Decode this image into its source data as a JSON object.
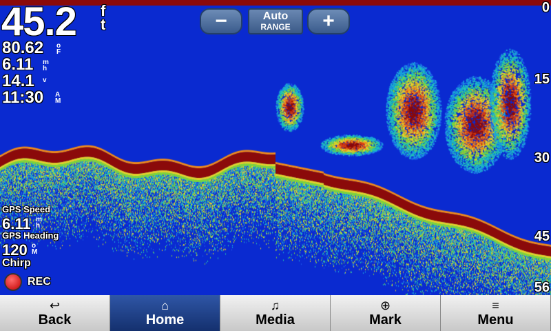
{
  "depth": {
    "value": "45.2",
    "unit_top": "f",
    "unit_bottom": "t"
  },
  "stats": [
    {
      "value": "80.62",
      "unit_top": "o",
      "unit_bottom": "F"
    },
    {
      "value": "6.11",
      "unit_top": "m",
      "unit_bottom": "h"
    },
    {
      "value": "14.1",
      "unit_top": "",
      "unit_bottom": "v"
    },
    {
      "value": "11:30",
      "unit_top": "A",
      "unit_bottom": "M"
    }
  ],
  "range": {
    "minus_label": "−",
    "plus_label": "+",
    "mode": "Auto",
    "mode_sub": "RANGE"
  },
  "scale": [
    "0",
    "15",
    "30",
    "45",
    "56"
  ],
  "gps": {
    "speed_label": "GPS Speed",
    "speed_value": "6.11",
    "speed_unit_top": "m",
    "speed_unit_bottom": "h",
    "heading_label": "GPS Heading",
    "heading_value": "120",
    "heading_unit_top": "o",
    "heading_unit_bottom": "M",
    "mode": "Chirp"
  },
  "rec_label": "REC",
  "nav": [
    {
      "icon": "↩",
      "icon_name": "back-arrow-icon",
      "label": "Back"
    },
    {
      "icon": "⌂",
      "icon_name": "home-icon",
      "label": "Home",
      "active": true
    },
    {
      "icon": "♫",
      "icon_name": "music-note-icon",
      "label": "Media"
    },
    {
      "icon": "⊕",
      "icon_name": "crosshair-icon",
      "label": "Mark"
    },
    {
      "icon": "≡",
      "icon_name": "menu-list-icon",
      "label": "Menu"
    }
  ],
  "colors": {
    "water": "#0a2ad0",
    "bottom_return": "#8b0a0a",
    "active_nav": "#1f3f87"
  }
}
